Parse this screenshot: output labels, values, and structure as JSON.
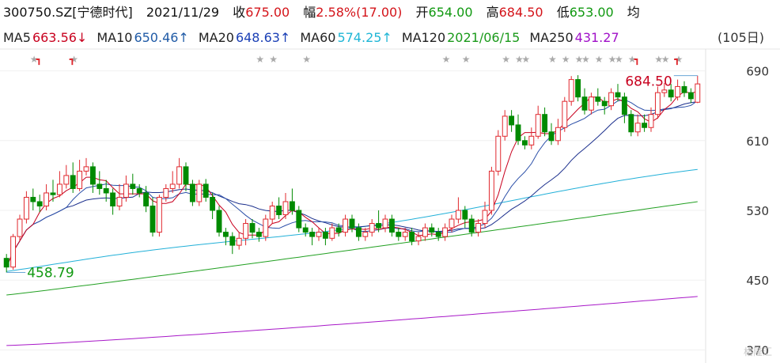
{
  "header": {
    "code": "300750.SZ[宁德时代]",
    "date": "2021/11/29",
    "close": {
      "label": "收",
      "value": "675.00"
    },
    "change": {
      "label": "幅",
      "value": "2.58%(17.00)"
    },
    "open": {
      "label": "开",
      "value": "654.00"
    },
    "high": {
      "label": "高",
      "value": "684.50"
    },
    "low": {
      "label": "低",
      "value": "653.00"
    },
    "avg_label": "均"
  },
  "ma_legend": [
    {
      "name": "MA5",
      "value": "663.56",
      "arrow": "↓",
      "color": "#c8001e"
    },
    {
      "name": "MA10",
      "value": "650.46",
      "arrow": "↑",
      "color": "#1f5aa6"
    },
    {
      "name": "MA20",
      "value": "648.63",
      "arrow": "↑",
      "color": "#1a3fb5"
    },
    {
      "name": "MA60",
      "value": "574.25",
      "arrow": "↑",
      "color": "#1fb6d6"
    },
    {
      "name": "MA120",
      "value": "2021/06/15",
      "arrow": "",
      "color": "#1a9a1a"
    },
    {
      "name": "MA250",
      "value": "431.27",
      "arrow": "",
      "color": "#a010c8"
    }
  ],
  "period_label": "(105日)",
  "watermark": "格隆汇",
  "colors": {
    "up": "#e0282e",
    "down": "#008a00",
    "ma5": "#c8001e",
    "ma10": "#2b4fa8",
    "ma20": "#1a2e8c",
    "ma60": "#22b0d8",
    "ma120": "#22a022",
    "ma250": "#a818c8"
  },
  "chart_data": {
    "type": "candlestick",
    "title": "300750.SZ[宁德时代]",
    "ylim": [
      355,
      715
    ],
    "yticks": [
      690,
      610,
      530,
      450,
      370
    ],
    "annotations": [
      {
        "text": "684.50",
        "value": 684.5,
        "kind": "high"
      },
      {
        "text": "458.79",
        "value": 458.79,
        "kind": "low"
      }
    ],
    "candles": [
      [
        475,
        465,
        480,
        458.79
      ],
      [
        465,
        500,
        503,
        462
      ],
      [
        500,
        520,
        525,
        495
      ],
      [
        520,
        545,
        552,
        515
      ],
      [
        545,
        540,
        555,
        530
      ],
      [
        540,
        535,
        548,
        528
      ],
      [
        535,
        550,
        560,
        530
      ],
      [
        550,
        548,
        565,
        540
      ],
      [
        548,
        560,
        575,
        545
      ],
      [
        560,
        570,
        582,
        555
      ],
      [
        570,
        555,
        585,
        550
      ],
      [
        555,
        575,
        588,
        552
      ],
      [
        575,
        580,
        590,
        570
      ],
      [
        580,
        560,
        585,
        550
      ],
      [
        560,
        555,
        575,
        548
      ],
      [
        555,
        550,
        565,
        540
      ],
      [
        550,
        535,
        555,
        525
      ],
      [
        535,
        545,
        560,
        530
      ],
      [
        545,
        560,
        570,
        540
      ],
      [
        560,
        555,
        572,
        548
      ],
      [
        555,
        550,
        560,
        545
      ],
      [
        550,
        535,
        558,
        528
      ],
      [
        535,
        505,
        545,
        500
      ],
      [
        505,
        545,
        548,
        500
      ],
      [
        545,
        555,
        560,
        540
      ],
      [
        555,
        560,
        575,
        550
      ],
      [
        560,
        580,
        590,
        555
      ],
      [
        580,
        560,
        585,
        552
      ],
      [
        560,
        540,
        565,
        535
      ],
      [
        540,
        560,
        565,
        535
      ],
      [
        560,
        545,
        566,
        540
      ],
      [
        545,
        530,
        550,
        520
      ],
      [
        530,
        505,
        535,
        500
      ],
      [
        505,
        500,
        510,
        490
      ],
      [
        500,
        490,
        505,
        480
      ],
      [
        490,
        498,
        505,
        485
      ],
      [
        498,
        515,
        520,
        490
      ],
      [
        515,
        505,
        520,
        498
      ],
      [
        505,
        500,
        510,
        494
      ],
      [
        500,
        520,
        525,
        495
      ],
      [
        520,
        535,
        540,
        515
      ],
      [
        535,
        525,
        545,
        520
      ],
      [
        525,
        540,
        550,
        520
      ],
      [
        540,
        530,
        555,
        525
      ],
      [
        530,
        510,
        535,
        505
      ],
      [
        510,
        505,
        515,
        500
      ],
      [
        505,
        500,
        510,
        490
      ],
      [
        500,
        505,
        510,
        495
      ],
      [
        505,
        498,
        510,
        490
      ],
      [
        498,
        510,
        515,
        495
      ],
      [
        510,
        505,
        515,
        500
      ],
      [
        505,
        520,
        525,
        500
      ],
      [
        520,
        510,
        525,
        505
      ],
      [
        510,
        500,
        515,
        495
      ],
      [
        500,
        505,
        510,
        495
      ],
      [
        505,
        515,
        520,
        500
      ],
      [
        515,
        510,
        530,
        505
      ],
      [
        510,
        520,
        525,
        505
      ],
      [
        520,
        505,
        525,
        500
      ],
      [
        505,
        500,
        510,
        495
      ],
      [
        500,
        505,
        510,
        495
      ],
      [
        505,
        495,
        510,
        490
      ],
      [
        495,
        500,
        505,
        490
      ],
      [
        500,
        510,
        515,
        495
      ],
      [
        510,
        505,
        515,
        500
      ],
      [
        505,
        500,
        510,
        495
      ],
      [
        500,
        510,
        515,
        495
      ],
      [
        510,
        520,
        525,
        505
      ],
      [
        520,
        530,
        545,
        515
      ],
      [
        530,
        520,
        535,
        510
      ],
      [
        520,
        505,
        525,
        500
      ],
      [
        505,
        515,
        520,
        500
      ],
      [
        515,
        530,
        540,
        510
      ],
      [
        530,
        575,
        580,
        525
      ],
      [
        575,
        615,
        622,
        570
      ],
      [
        615,
        638,
        645,
        610
      ],
      [
        638,
        628,
        645,
        620
      ],
      [
        628,
        610,
        640,
        605
      ],
      [
        610,
        605,
        615,
        600
      ],
      [
        605,
        615,
        625,
        600
      ],
      [
        615,
        640,
        650,
        612
      ],
      [
        640,
        620,
        648,
        615
      ],
      [
        620,
        610,
        630,
        605
      ],
      [
        610,
        625,
        635,
        605
      ],
      [
        625,
        655,
        660,
        620
      ],
      [
        655,
        680,
        684,
        650
      ],
      [
        680,
        660,
        685,
        655
      ],
      [
        660,
        645,
        670,
        640
      ],
      [
        645,
        660,
        665,
        640
      ],
      [
        660,
        655,
        670,
        650
      ],
      [
        655,
        650,
        660,
        640
      ],
      [
        650,
        665,
        670,
        645
      ],
      [
        665,
        660,
        675,
        655
      ],
      [
        660,
        640,
        665,
        630
      ],
      [
        640,
        620,
        645,
        615
      ],
      [
        620,
        630,
        640,
        615
      ],
      [
        630,
        625,
        640,
        620
      ],
      [
        625,
        640,
        648,
        620
      ],
      [
        640,
        665,
        672,
        635
      ],
      [
        665,
        668,
        676,
        660
      ],
      [
        668,
        660,
        675,
        655
      ],
      [
        660,
        672,
        680,
        656
      ],
      [
        672,
        665,
        678,
        660
      ],
      [
        665,
        658,
        670,
        653
      ],
      [
        654,
        675,
        684.5,
        653
      ]
    ],
    "ma60_end": 574.25,
    "ma120_end": 540,
    "ma250_end": 431.27
  }
}
